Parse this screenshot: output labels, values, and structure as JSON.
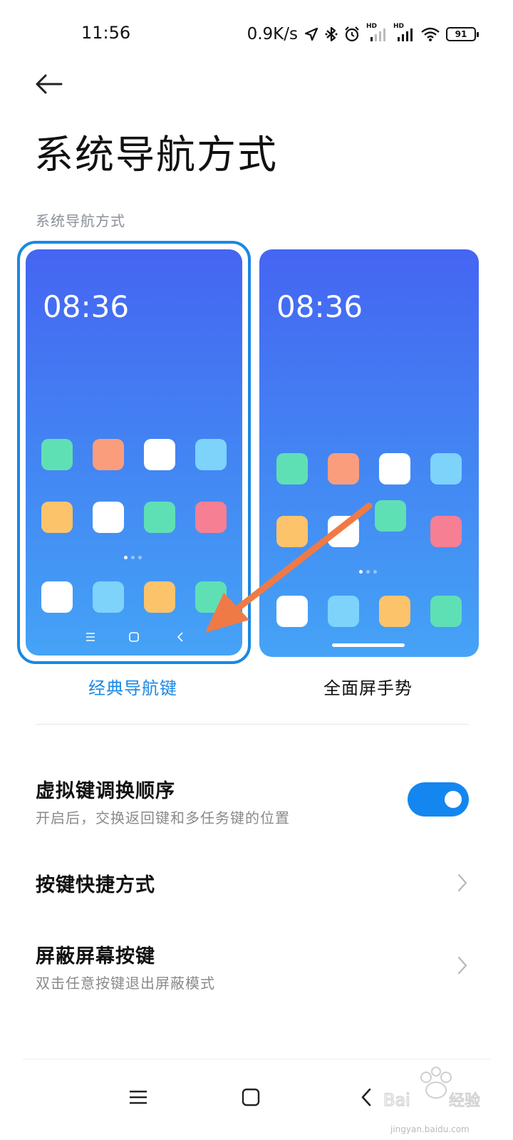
{
  "status_bar": {
    "time": "11:56",
    "net_speed": "0.9K/s",
    "battery": "91",
    "hd1": "HD",
    "hd2": "HD"
  },
  "header": {
    "title": "系统导航方式"
  },
  "section": {
    "label": "系统导航方式"
  },
  "options": [
    {
      "label": "经典导航键",
      "preview_time": "08:36",
      "selected": true
    },
    {
      "label": "全面屏手势",
      "preview_time": "08:36",
      "selected": false
    }
  ],
  "settings": {
    "swap_order": {
      "title": "虚拟键调换顺序",
      "subtitle": "开启后，交换返回键和多任务键的位置",
      "enabled": true
    },
    "shortcuts": {
      "title": "按键快捷方式"
    },
    "block_keys": {
      "title": "屏蔽屏幕按键",
      "subtitle": "双击任意按键退出屏蔽模式"
    }
  },
  "watermark": {
    "brand": "Bai 经验",
    "url": "jingyan.baidu.com"
  },
  "colors": {
    "accent": "#1a88e3",
    "toggle": "#1486f0",
    "arrow": "#f07a45",
    "icon_green": "#5fe0b4",
    "icon_orange": "#f99d7d",
    "icon_blue": "#7dd3fa",
    "icon_yellow": "#fdc36b",
    "icon_pink": "#f77f93",
    "icon_white": "#ffffff"
  }
}
